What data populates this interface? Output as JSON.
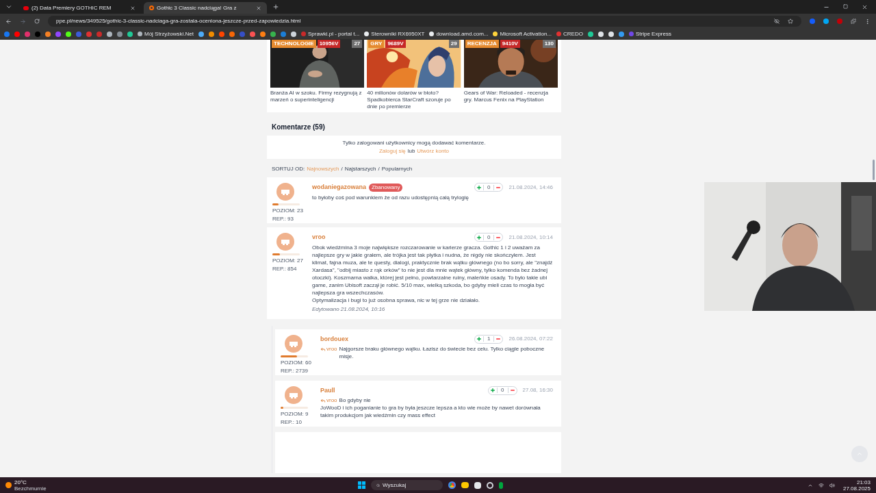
{
  "browser": {
    "tabs": [
      {
        "title": "(2) Data Premiery GOTHIC REM",
        "selected": false,
        "kind": "video"
      },
      {
        "title": "Gothic 3 Classic nadciąga! Gra z",
        "selected": true,
        "kind": "site"
      }
    ],
    "url": "ppe.pl/news/349525/gothic-3-classic-nadciaga-gra-zostala-oceniona-jeszcze-przed-zapowiedzia.html",
    "bookmarks": [
      {
        "color": "#1877f2"
      },
      {
        "color": "#ff0000"
      },
      {
        "color": "#e1306c"
      },
      {
        "color": "#000000"
      },
      {
        "color": "#f48024"
      },
      {
        "color": "#9146ff"
      },
      {
        "color": "#53fc18"
      },
      {
        "color": "#3b5bdb"
      },
      {
        "color": "#e03131"
      },
      {
        "color": "#c92a2a"
      },
      {
        "color": "#adb5bd"
      },
      {
        "color": "#868e96"
      },
      {
        "color": "#20c997"
      },
      {
        "label": "Mój Strzyżowski.Net",
        "color": "#adb5bd"
      },
      {
        "color": "#4dabf7"
      },
      {
        "color": "#f08c00"
      },
      {
        "color": "#ff4500"
      },
      {
        "color": "#f76707"
      },
      {
        "color": "#364fc7"
      },
      {
        "color": "#fa5252"
      },
      {
        "color": "#fd7e14"
      },
      {
        "color": "#37b24d"
      },
      {
        "color": "#1c7ed6"
      },
      {
        "color": "#ced4da"
      },
      {
        "label": "Sprawki.pl - portal t...",
        "color": "#c92a2a"
      },
      {
        "label": "Sterowniki RX6950XT",
        "color": "#e9ecef"
      },
      {
        "label": "download.amd.com...",
        "color": "#e9ecef"
      },
      {
        "label": "Microsoft Activation...",
        "color": "#ffd43b"
      },
      {
        "label": "CREDO",
        "color": "#e03131"
      },
      {
        "color": "#20c997"
      },
      {
        "color": "#dee2e6"
      },
      {
        "color": "#dee2e6"
      },
      {
        "color": "#339af0"
      },
      {
        "label": "Stripe Express",
        "color": "#7048e8"
      }
    ]
  },
  "articles": [
    {
      "tag": "TECHNOLOGIE",
      "votes": "10956V",
      "comments": "27",
      "title": "Branża AI w szoku. Firmy rezygnują z marzeń o superinteligencji",
      "kind": "person"
    },
    {
      "tag": "GRY",
      "votes": "9689V",
      "comments": "29",
      "title": "40 milionów dolarów w błoto? Spadkobierca StarCraft szoruje po dnie po premierze",
      "kind": "fantasy"
    },
    {
      "tag": "RECENZJA",
      "votes": "9410V",
      "comments": "130",
      "title": "Gears of War: Reloaded - recenzja gry. Marcus Fenix na PlayStation",
      "kind": "soldier"
    }
  ],
  "comments_section": {
    "heading": "Komentarze (59)",
    "login_notice": "Tylko zalogowani użytkownicy mogą dodawać komentarze.",
    "login_link": "Zaloguj się",
    "or": "lub",
    "register_link": "Utwórz konto",
    "sort_label": "SORTUJ OD:",
    "sort_separator": "/",
    "sort_options": [
      {
        "label": "Najnowszych",
        "selected": true
      },
      {
        "label": "Najstarszych",
        "selected": false
      },
      {
        "label": "Popularnych",
        "selected": false
      }
    ],
    "comments": [
      {
        "kind": "comment",
        "author": "wodaniegazowana",
        "badge": "Zbanowany",
        "level": 0.23,
        "level_text": "POZIOM: 23",
        "rep": "REP.: 93",
        "score": "0",
        "date": "21.08.2024, 14:46",
        "paragraphs": [
          "to byłoby coś pod warunkiem że od razu udostępnią całą trylogię"
        ]
      },
      {
        "kind": "comment",
        "author": "vroo",
        "level": 0.27,
        "level_text": "POZIOM: 27",
        "rep": "REP.: 854",
        "score": "0",
        "date": "21.08.2024, 10:14",
        "paragraphs": [
          "Obok wiedźmina 3 moje największe rozczarowanie w karierze gracza. Gothic 1 i 2 uważam za najlepsze gry w jakie grałem, ale trójka jest tak płytka i nudna, że nigdy nie skończyłem. Jest klimat, fajna muza, ale te questy, dialogi, praktycznie brak wątku głównego (no bo sorry, ale \"znajdź Xardasa\", \"odbij miasto z rąk orków\" to nie jest dla mnie wątek główny, tylko komenda bez żadnej otoczki). Koszmarna walka, której jest pełno, powtarzalne ruiny, maleńkie osady. To było takie ubi game, zanim Ubisoft zaczął je robić. 5/10 max, wielką szkoda, bo gdyby mieli czas to mogła być najlepsza gra wszechczasów.",
          "Optymalizacja i bugi to już osobna sprawa, nic w tej grze nie działało."
        ],
        "edited": "Edytowano 21.08.2024, 10:16"
      },
      {
        "kind": "reply",
        "author": "bordouex",
        "level": 0.6,
        "level_text": "POZIOM: 60",
        "rep": "REP.: 2739",
        "score": "1",
        "date": "26.08.2024, 07:22",
        "reply_to": "vroo",
        "paragraphs": [
          "Najgorsze braku głównego wątku. Łazisz do świecie bez celu. Tylko ciągle poboczne misje."
        ]
      },
      {
        "kind": "reply",
        "author": "Paull",
        "level": 0.09,
        "level_text": "POZIOM: 9",
        "rep": "REP.: 10",
        "score": "0",
        "date": "27.08, 16:30",
        "reply_to": "vroo",
        "paragraphs": [
          "Bo gdyby nie",
          "JoWooD i ich poganianie to gra by była jeszcze lepsza a kto wie może by nawet dorównała takim produkcjom jak wiedźmin czy mass effect"
        ]
      }
    ]
  },
  "taskbar": {
    "weather_temp": "20°C",
    "weather_desc": "Bezchmurnie",
    "search_placeholder": "Wyszukaj",
    "time": "21:03",
    "date": "27.08.2025"
  }
}
